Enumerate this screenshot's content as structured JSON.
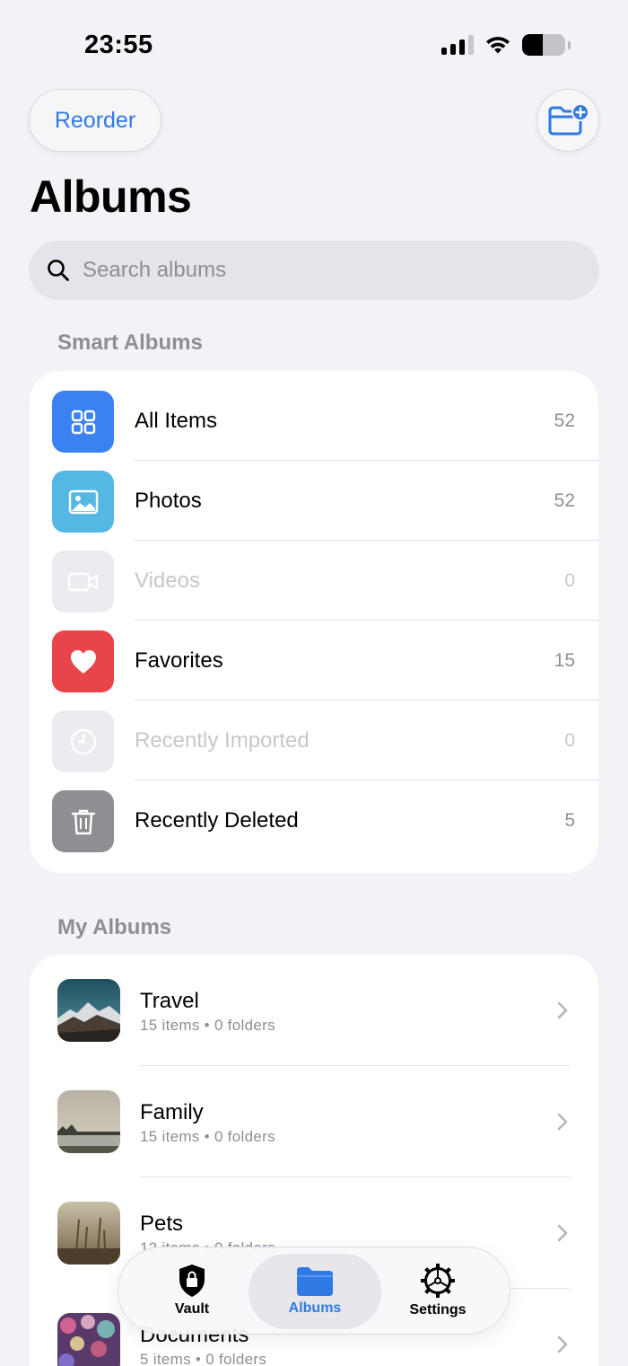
{
  "status_bar": {
    "time": "23:55"
  },
  "header": {
    "reorder_label": "Reorder",
    "new_album_icon": "folder-plus-icon",
    "title": "Albums"
  },
  "search": {
    "placeholder": "Search albums",
    "value": ""
  },
  "smart_albums": {
    "section_title": "Smart Albums",
    "items": [
      {
        "label": "All Items",
        "count": "52",
        "icon": "grid-icon",
        "color": "#3b82f0",
        "enabled": true
      },
      {
        "label": "Photos",
        "count": "52",
        "icon": "photo-icon",
        "color": "#55b8e4",
        "enabled": true
      },
      {
        "label": "Videos",
        "count": "0",
        "icon": "video-icon",
        "color": "#ececf0",
        "enabled": false
      },
      {
        "label": "Favorites",
        "count": "15",
        "icon": "heart-icon",
        "color": "#e8454a",
        "enabled": true
      },
      {
        "label": "Recently Imported",
        "count": "0",
        "icon": "clock-icon",
        "color": "#ececf0",
        "enabled": false
      },
      {
        "label": "Recently Deleted",
        "count": "5",
        "icon": "trash-icon",
        "color": "#8e8e93",
        "enabled": true
      }
    ]
  },
  "my_albums": {
    "section_title": "My Albums",
    "items": [
      {
        "name": "Travel",
        "items": "15 items",
        "folders": "0 folders"
      },
      {
        "name": "Family",
        "items": "15 items",
        "folders": "0 folders"
      },
      {
        "name": "Pets",
        "items": "12 items",
        "folders": "0 folders"
      },
      {
        "name": "Documents",
        "items": "5 items",
        "folders": "0 folders"
      }
    ]
  },
  "tab_bar": {
    "tabs": [
      {
        "label": "Vault",
        "icon": "shield-lock-icon",
        "active": false
      },
      {
        "label": "Albums",
        "icon": "folder-icon",
        "active": true
      },
      {
        "label": "Settings",
        "icon": "gear-icon",
        "active": false
      }
    ]
  },
  "colors": {
    "accent": "#2f7ae5",
    "background": "#f2f2f7",
    "secondary_text": "#8e8e93"
  }
}
